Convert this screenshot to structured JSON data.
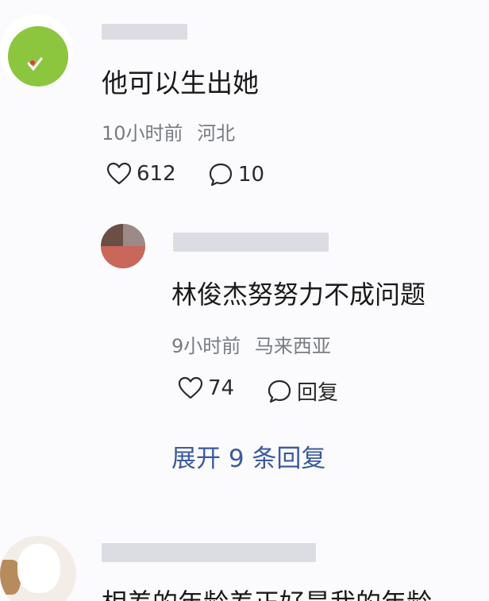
{
  "comments": [
    {
      "text": "他可以生出她",
      "time": "10小时前",
      "location": "河北",
      "likes": "612",
      "replies": "10"
    },
    {
      "text": "林俊杰努努力不成问题",
      "time": "9小时前",
      "location": "马来西亚",
      "likes": "74",
      "reply_label": "回复"
    }
  ],
  "expand_replies": "展开 9 条回复",
  "third_comment_partial": "相差的年龄差正好是我的年龄",
  "colors": {
    "link": "#3d5a9e",
    "meta": "#777b82",
    "text": "#1a1a1a",
    "avatar_green": "#8cc63f"
  },
  "icons": [
    "heart-icon",
    "comment-bubble-icon"
  ]
}
